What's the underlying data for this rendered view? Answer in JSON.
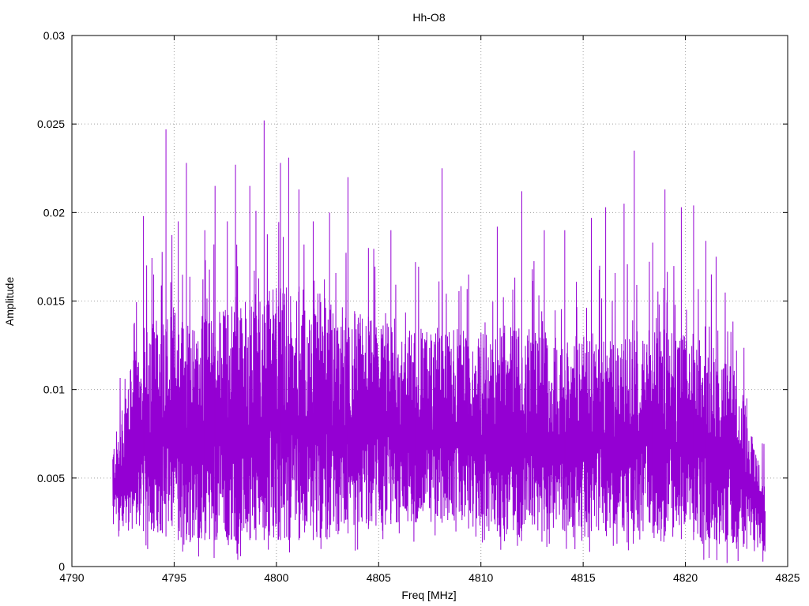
{
  "chart_data": {
    "type": "line",
    "title": "Hh-O8",
    "xlabel": "Freq [MHz]",
    "ylabel": "Amplitude",
    "xlim": [
      4790,
      4825
    ],
    "ylim": [
      0,
      0.03
    ],
    "x_ticks": [
      "4790",
      "4795",
      "4800",
      "4805",
      "4810",
      "4815",
      "4820",
      "4825"
    ],
    "y_ticks": [
      "0",
      "0.005",
      "0.01",
      "0.015",
      "0.02",
      "0.025",
      "0.03"
    ],
    "grid": true,
    "legend": "none",
    "series": [
      {
        "color": "#9400d3",
        "x_range": [
          4792.0,
          4823.9
        ],
        "envelope": {
          "x": [
            4792.0,
            4792.5,
            4793.0,
            4794.0,
            4795.0,
            4796.0,
            4798.0,
            4800.0,
            4802.0,
            4804.0,
            4806.0,
            4808.0,
            4810.0,
            4812.0,
            4814.0,
            4816.0,
            4818.0,
            4820.0,
            4821.5,
            4822.5,
            4823.0,
            4823.5,
            4823.9
          ],
          "typical_max": [
            0.007,
            0.009,
            0.012,
            0.014,
            0.015,
            0.014,
            0.015,
            0.016,
            0.0155,
            0.0145,
            0.0135,
            0.0135,
            0.0135,
            0.0135,
            0.013,
            0.013,
            0.0135,
            0.0135,
            0.0125,
            0.011,
            0.009,
            0.007,
            0.005
          ],
          "typical_min": [
            0.002,
            0.002,
            0.002,
            0.002,
            0.0015,
            0.0015,
            0.0015,
            0.0015,
            0.0015,
            0.002,
            0.0025,
            0.0025,
            0.002,
            0.002,
            0.002,
            0.002,
            0.002,
            0.0015,
            0.0015,
            0.001,
            0.001,
            0.001,
            0.001
          ]
        },
        "peaks": [
          {
            "x": 4793.5,
            "y": 0.0198
          },
          {
            "x": 4794.0,
            "y": 0.0165
          },
          {
            "x": 4794.6,
            "y": 0.0247
          },
          {
            "x": 4795.2,
            "y": 0.0195
          },
          {
            "x": 4795.6,
            "y": 0.0228
          },
          {
            "x": 4796.5,
            "y": 0.019
          },
          {
            "x": 4797.0,
            "y": 0.0215
          },
          {
            "x": 4797.6,
            "y": 0.0195
          },
          {
            "x": 4798.0,
            "y": 0.0227
          },
          {
            "x": 4798.7,
            "y": 0.0215
          },
          {
            "x": 4799.0,
            "y": 0.0201
          },
          {
            "x": 4799.4,
            "y": 0.0252
          },
          {
            "x": 4800.2,
            "y": 0.0228
          },
          {
            "x": 4800.6,
            "y": 0.0231
          },
          {
            "x": 4801.1,
            "y": 0.0213
          },
          {
            "x": 4801.8,
            "y": 0.0195
          },
          {
            "x": 4802.6,
            "y": 0.02
          },
          {
            "x": 4803.5,
            "y": 0.022
          },
          {
            "x": 4804.5,
            "y": 0.018
          },
          {
            "x": 4805.6,
            "y": 0.019
          },
          {
            "x": 4806.8,
            "y": 0.0172
          },
          {
            "x": 4808.1,
            "y": 0.0225
          },
          {
            "x": 4809.4,
            "y": 0.0165
          },
          {
            "x": 4810.8,
            "y": 0.0192
          },
          {
            "x": 4812.0,
            "y": 0.0212
          },
          {
            "x": 4813.1,
            "y": 0.019
          },
          {
            "x": 4814.1,
            "y": 0.019
          },
          {
            "x": 4815.4,
            "y": 0.0197
          },
          {
            "x": 4816.1,
            "y": 0.0203
          },
          {
            "x": 4817.0,
            "y": 0.0205
          },
          {
            "x": 4817.5,
            "y": 0.0235
          },
          {
            "x": 4818.4,
            "y": 0.0183
          },
          {
            "x": 4819.0,
            "y": 0.0213
          },
          {
            "x": 4819.8,
            "y": 0.0203
          },
          {
            "x": 4820.4,
            "y": 0.0204
          },
          {
            "x": 4821.0,
            "y": 0.0184
          },
          {
            "x": 4821.5,
            "y": 0.0175
          },
          {
            "x": 4822.5,
            "y": 0.0122
          },
          {
            "x": 4823.0,
            "y": 0.0095
          }
        ]
      }
    ]
  }
}
